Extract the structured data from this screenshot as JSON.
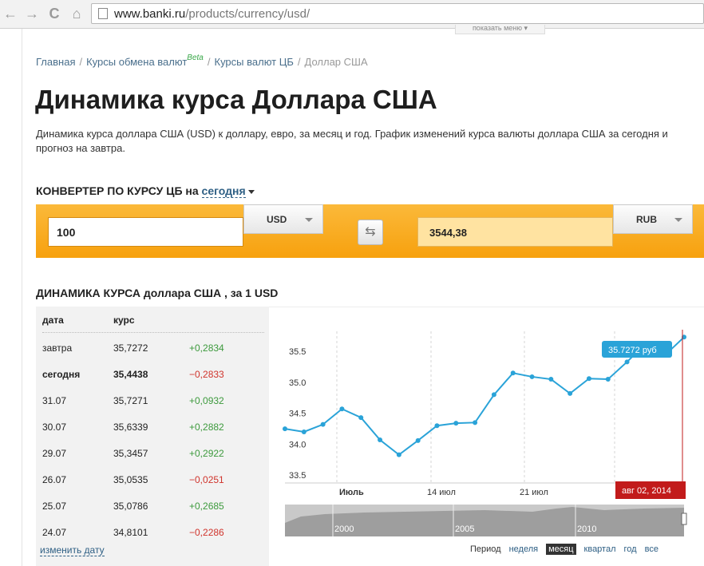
{
  "browser": {
    "url_host": "www.banki.ru",
    "url_path": "/products/currency/usd/"
  },
  "show_menu": "показать меню",
  "breadcrumb": {
    "home": "Главная",
    "exchange": "Курсы обмена валют",
    "beta": "Beta",
    "cb": "Курсы валют ЦБ",
    "current": "Доллар США"
  },
  "title": "Динамика курса Доллара США",
  "description": "Динамика курса доллара США (USD) к доллару, евро, за месяц и год. График изменений курса валюты доллара США за сегодня и прогноз на завтра.",
  "converter": {
    "heading": "КОНВЕРТЕР ПО КУРСУ ЦБ на",
    "date_label": "сегодня",
    "amount": "100",
    "from_currency": "USD",
    "result": "3544,38",
    "to_currency": "RUB"
  },
  "dynamics_heading": "ДИНАМИКА КУРСА доллара США , за 1 USD",
  "table": {
    "headers": [
      "дата",
      "курс"
    ],
    "rows": [
      {
        "date": "завтра",
        "rate": "35,7272",
        "change": "+0,2834",
        "sign": "pos",
        "bold": false
      },
      {
        "date": "сегодня",
        "rate": "35,4438",
        "change": "−0,2833",
        "sign": "neg",
        "bold": true
      },
      {
        "date": "31.07",
        "rate": "35,7271",
        "change": "+0,0932",
        "sign": "pos",
        "bold": false
      },
      {
        "date": "30.07",
        "rate": "35,6339",
        "change": "+0,2882",
        "sign": "pos",
        "bold": false
      },
      {
        "date": "29.07",
        "rate": "35,3457",
        "change": "+0,2922",
        "sign": "pos",
        "bold": false
      },
      {
        "date": "26.07",
        "rate": "35,0535",
        "change": "−0,0251",
        "sign": "neg",
        "bold": false
      },
      {
        "date": "25.07",
        "rate": "35,0786",
        "change": "+0,2685",
        "sign": "pos",
        "bold": false
      },
      {
        "date": "24.07",
        "rate": "34,8101",
        "change": "−0,2286",
        "sign": "neg",
        "bold": false
      }
    ],
    "change_date_link": "изменить дату"
  },
  "chart_data": {
    "type": "line",
    "ylim": [
      33.4,
      35.85
    ],
    "y_ticks": [
      "33.5",
      "34.0",
      "34.5",
      "35.0",
      "35.5"
    ],
    "x_tick_labels": [
      "Июль",
      "14 июл",
      "21 июл"
    ],
    "series": [
      {
        "values": [
          34.25,
          34.2,
          34.32,
          34.57,
          34.43,
          34.07,
          33.83,
          34.06,
          34.3,
          34.34,
          34.35,
          34.8,
          35.15,
          35.09,
          35.05,
          34.82,
          35.06,
          35.05,
          35.33,
          35.63,
          35.44,
          35.73
        ]
      }
    ],
    "tooltip": "35.7272 руб",
    "crosshair_label": "авг 02, 2014",
    "navigator_labels": [
      "2000",
      "2005",
      "2010"
    ],
    "colors": {
      "line": "#2aa3d8",
      "crosshair": "#c21b1b",
      "tooltip": "#2aa3d8"
    }
  },
  "period": {
    "label": "Период",
    "options": [
      "неделя",
      "месяц",
      "квартал",
      "год",
      "все"
    ],
    "active": "месяц"
  }
}
